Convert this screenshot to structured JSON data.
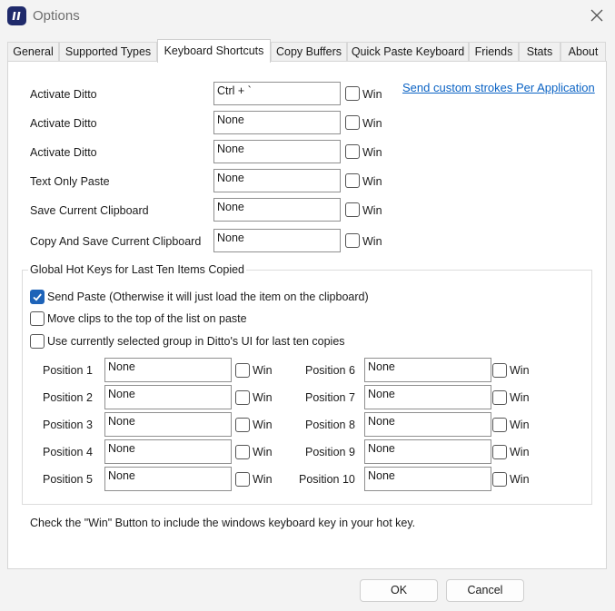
{
  "window": {
    "title": "Options"
  },
  "tabs": [
    "General",
    "Supported Types",
    "Keyboard Shortcuts",
    "Copy Buffers",
    "Quick Paste Keyboard",
    "Friends",
    "Stats",
    "About"
  ],
  "link_label": "Send custom strokes Per Application",
  "win_label": "Win",
  "shortcuts": [
    {
      "label": "Activate Ditto",
      "value": "Ctrl + `",
      "win": false
    },
    {
      "label": "Activate Ditto",
      "value": "None",
      "win": false
    },
    {
      "label": "Activate Ditto",
      "value": "None",
      "win": false
    },
    {
      "label": "Text Only Paste",
      "value": "None",
      "win": false
    },
    {
      "label": "Save Current Clipboard",
      "value": "None",
      "win": false
    },
    {
      "label": "Copy And Save Current Clipboard",
      "value": "None",
      "win": false
    }
  ],
  "group": {
    "title": "Global Hot Keys for Last Ten Items Copied",
    "options": [
      {
        "label": "Send Paste (Otherwise it will just load the item on the clipboard)",
        "checked": true
      },
      {
        "label": "Move clips to the top of the list on paste",
        "checked": false
      },
      {
        "label": "Use currently selected group in Ditto's UI for last ten copies",
        "checked": false
      }
    ],
    "positions": [
      {
        "label": "Position 1",
        "value": "None",
        "win": false
      },
      {
        "label": "Position 2",
        "value": "None",
        "win": false
      },
      {
        "label": "Position 3",
        "value": "None",
        "win": false
      },
      {
        "label": "Position 4",
        "value": "None",
        "win": false
      },
      {
        "label": "Position 5",
        "value": "None",
        "win": false
      },
      {
        "label": "Position 6",
        "value": "None",
        "win": false
      },
      {
        "label": "Position 7",
        "value": "None",
        "win": false
      },
      {
        "label": "Position 8",
        "value": "None",
        "win": false
      },
      {
        "label": "Position 9",
        "value": "None",
        "win": false
      },
      {
        "label": "Position 10",
        "value": "None",
        "win": false
      }
    ]
  },
  "hint": "Check the \"Win\" Button to include the windows keyboard key in your hot key.",
  "buttons": {
    "ok": "OK",
    "cancel": "Cancel"
  }
}
